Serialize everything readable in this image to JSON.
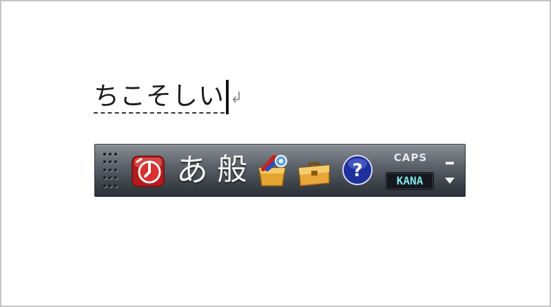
{
  "document": {
    "composing_text": "ちこそしい"
  },
  "ime_toolbar": {
    "mode_icon": "ime-app-icon",
    "input_mode": "あ",
    "conversion_mode": "般",
    "pad_icon": "ime-pad-icon",
    "tools_icon": "toolbox-icon",
    "help_icon": "help-icon",
    "caps_label": "CAPS",
    "kana_label": "KANA"
  }
}
